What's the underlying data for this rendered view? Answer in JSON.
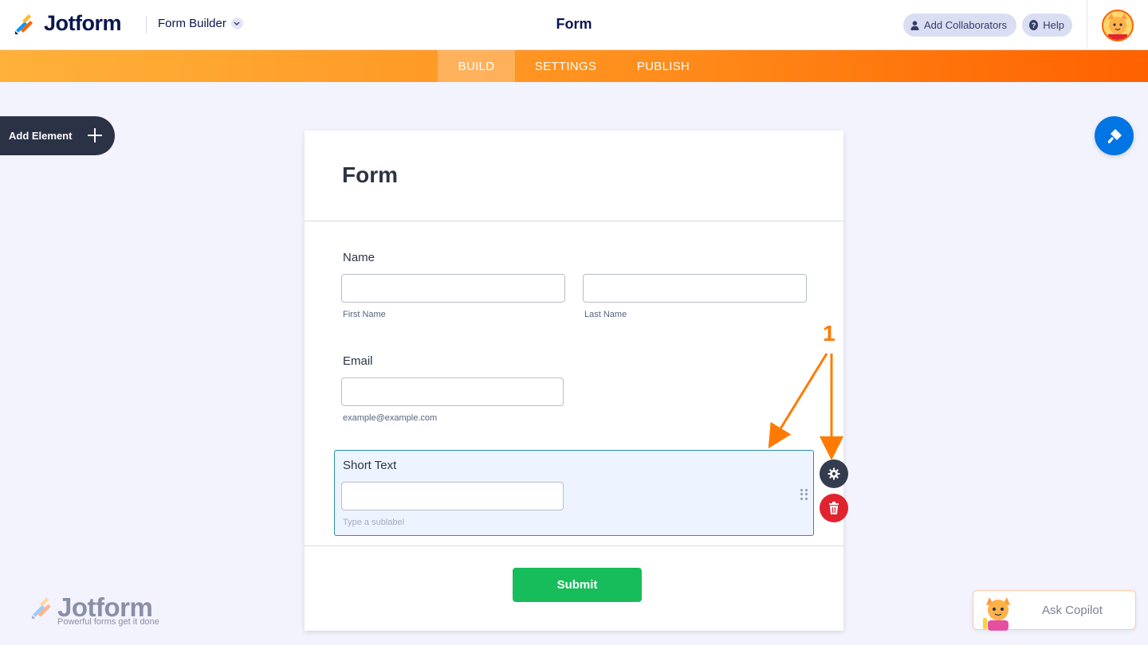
{
  "header": {
    "logo_text": "Jotform",
    "form_builder_label": "Form Builder",
    "page_title": "Form",
    "collaborators_label": "Add Collaborators",
    "help_label": "Help"
  },
  "nav": {
    "tabs": [
      {
        "label": "BUILD",
        "active": true
      },
      {
        "label": "SETTINGS",
        "active": false
      },
      {
        "label": "PUBLISH",
        "active": false
      }
    ]
  },
  "sidebar": {
    "add_element_label": "Add Element"
  },
  "form": {
    "title": "Form",
    "name_label": "Name",
    "first_name_sublabel": "First Name",
    "last_name_sublabel": "Last Name",
    "first_name_value": "",
    "last_name_value": "",
    "email_label": "Email",
    "email_value": "",
    "email_sublabel": "example@example.com",
    "short_text_label": "Short Text",
    "short_text_value": "",
    "short_text_sublabel_placeholder": "Type a sublabel",
    "submit_label": "Submit"
  },
  "annotation": {
    "number": "1",
    "color": "#ff7a00"
  },
  "footer": {
    "logo_text": "Jotform",
    "tagline": "Powerful forms get it done",
    "copilot_label": "Ask Copilot"
  },
  "colors": {
    "accent_orange": "#ff6100",
    "submit_green": "#18bd5b",
    "designer_blue": "#0075e3",
    "delete_red": "#e0232f",
    "selected_border": "#2a8fa3"
  },
  "icons": {
    "logo": "jotform-logo-icon",
    "chevron": "chevron-down-icon",
    "user": "user-icon",
    "help": "help-icon",
    "plus": "plus-icon",
    "designer": "paint-roller-icon",
    "gear": "gear-icon",
    "trash": "trash-icon",
    "drag": "drag-handle-icon"
  }
}
